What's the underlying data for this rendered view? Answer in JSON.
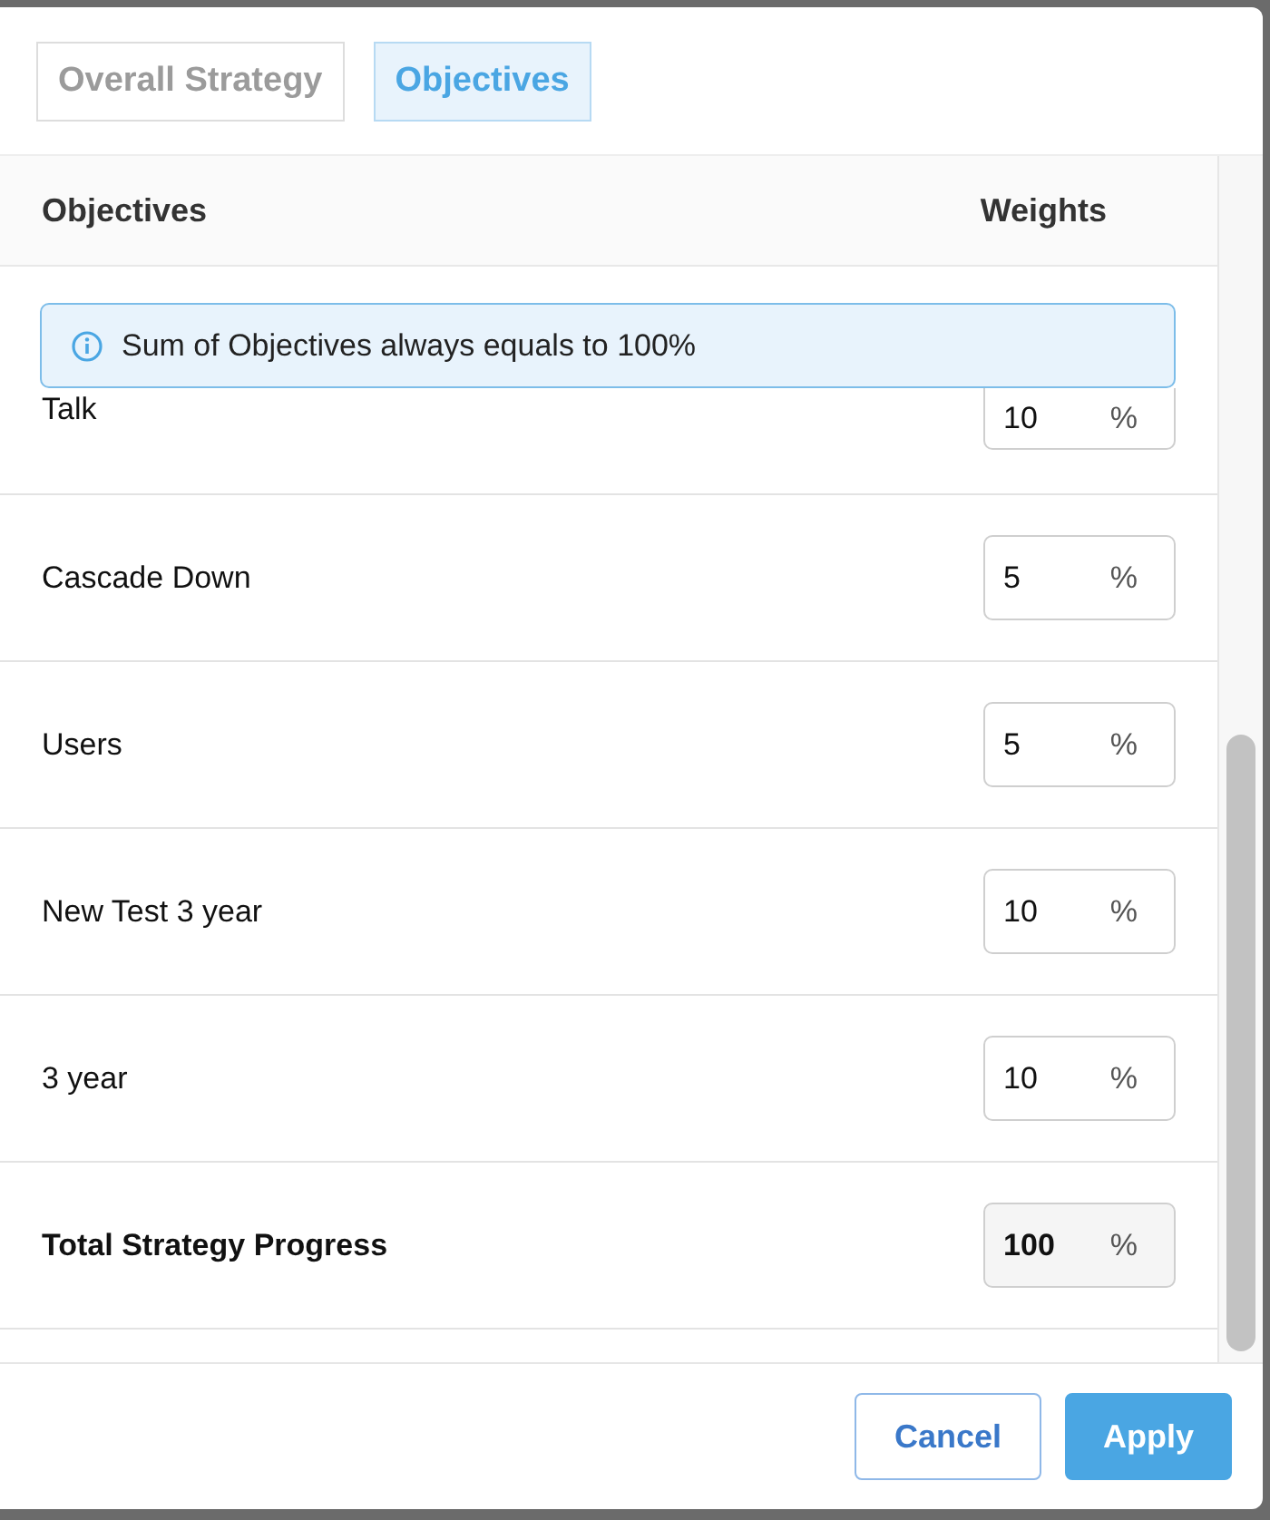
{
  "tabs": [
    {
      "label": "Overall Strategy",
      "selected": false
    },
    {
      "label": "Objectives",
      "selected": true
    }
  ],
  "table": {
    "columns": [
      "Objectives",
      "Weights"
    ],
    "info": "Sum of Objectives always equals to 100%",
    "rows": [
      {
        "name": "Talk",
        "value": "10",
        "unit": "%",
        "kind": "partial"
      },
      {
        "name": "Cascade Down",
        "value": "5",
        "unit": "%",
        "kind": "normal"
      },
      {
        "name": "Users",
        "value": "5",
        "unit": "%",
        "kind": "normal"
      },
      {
        "name": "New Test 3 year",
        "value": "10",
        "unit": "%",
        "kind": "normal"
      },
      {
        "name": "3 year",
        "value": "10",
        "unit": "%",
        "kind": "normal"
      },
      {
        "name": "Total Strategy Progress",
        "value": "100",
        "unit": "%",
        "kind": "total"
      }
    ]
  },
  "buttons": [
    {
      "label": "Cancel",
      "kind": "secondary"
    },
    {
      "label": "Apply",
      "kind": "primary"
    }
  ]
}
